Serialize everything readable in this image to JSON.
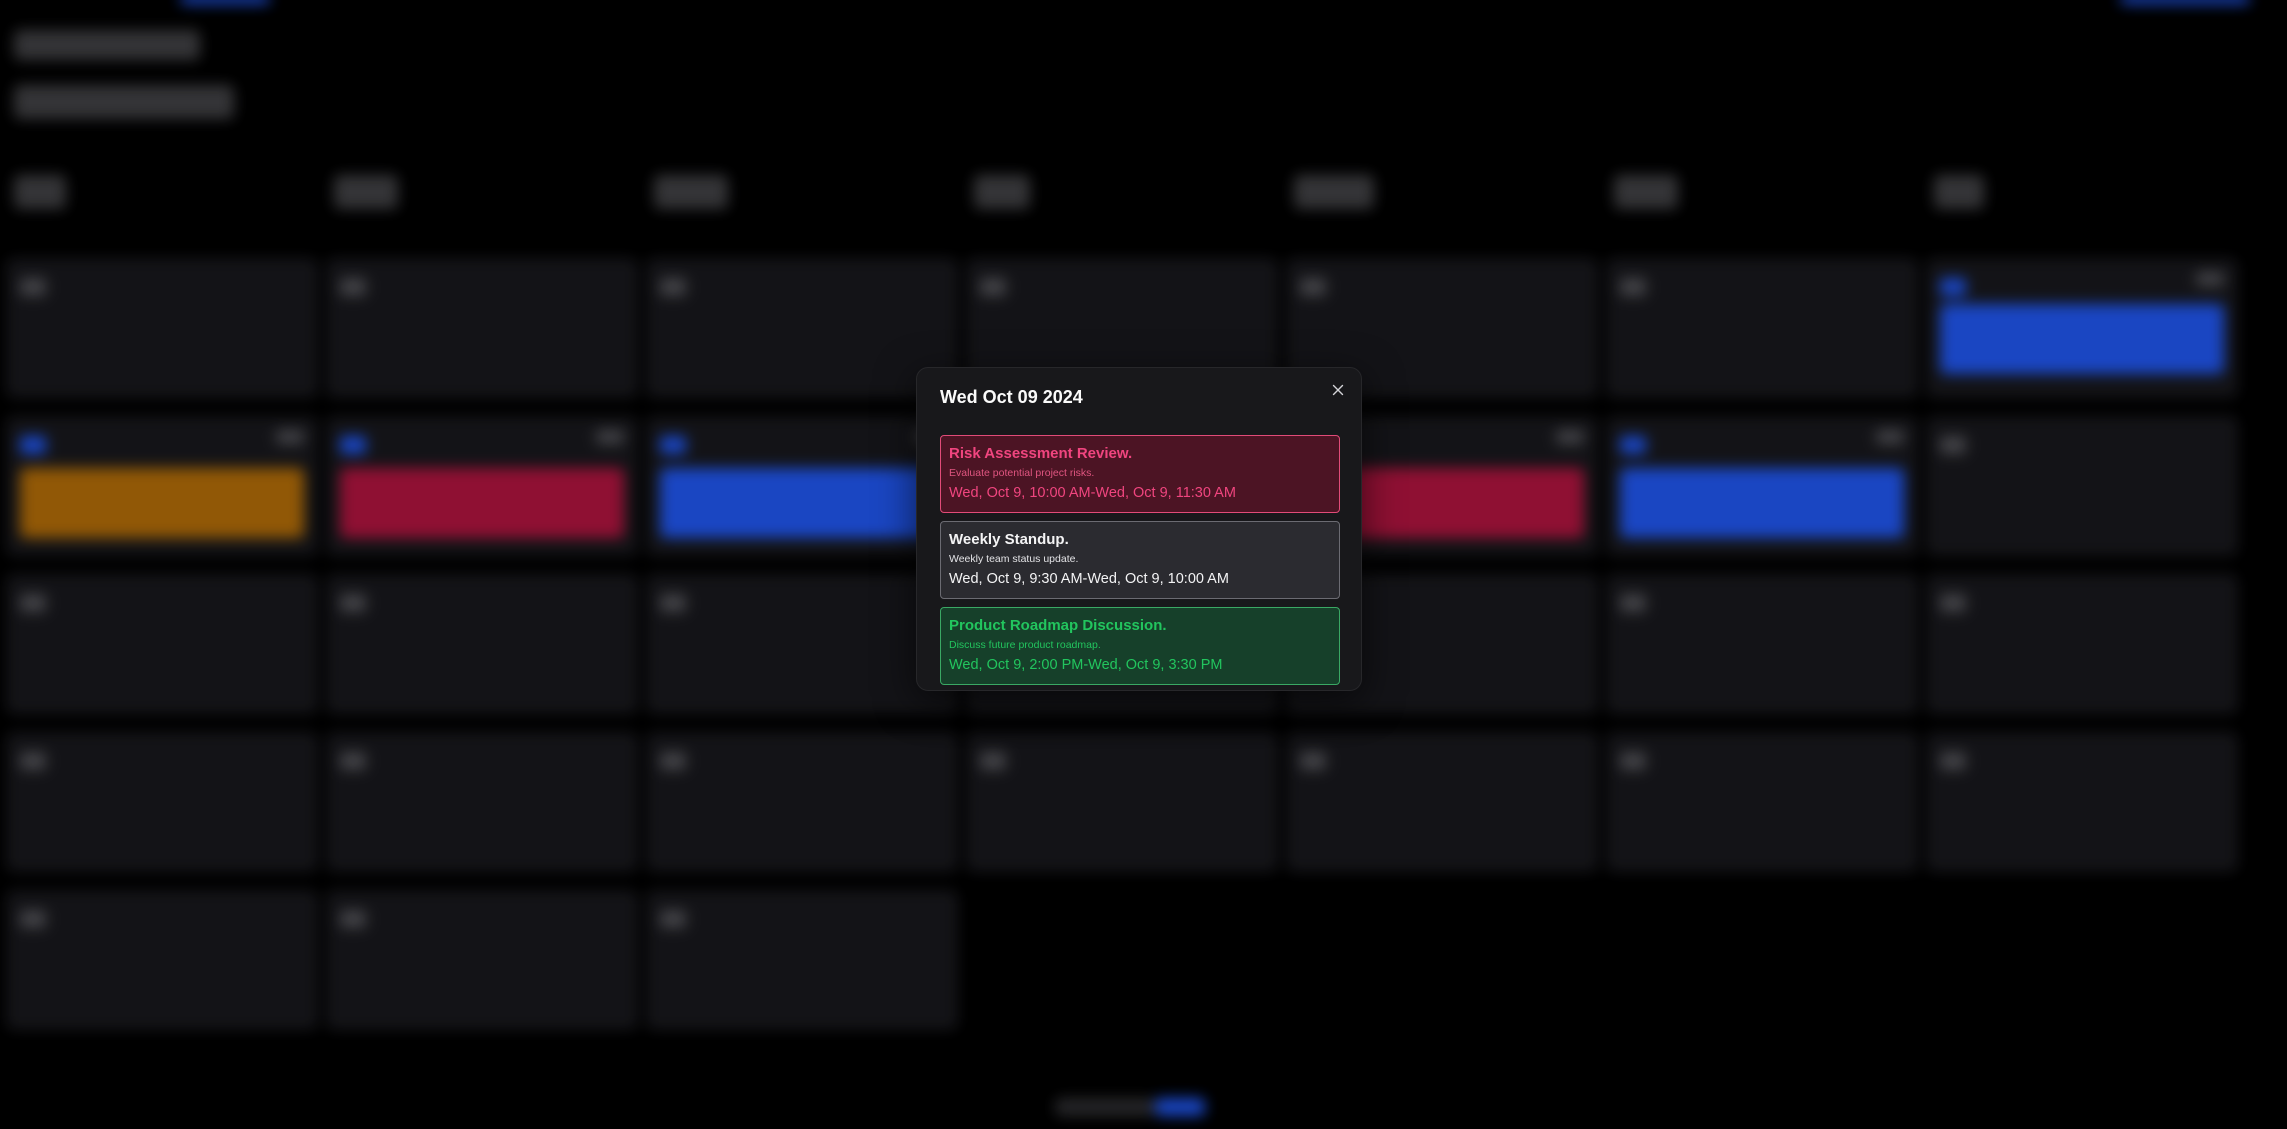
{
  "modal": {
    "title": "Wed Oct 09 2024",
    "close_icon": "close-icon",
    "events": [
      {
        "title": "Risk Assessment Review.",
        "description": "Evaluate potential project risks.",
        "time": "Wed, Oct 9, 10:00 AM-Wed, Oct 9, 11:30 AM",
        "color": "#f0457f"
      },
      {
        "title": "Weekly Standup.",
        "description": "Weekly team status update.",
        "time": "Wed, Oct 9, 9:30 AM-Wed, Oct 9, 10:00 AM",
        "color": "#f4f4f5"
      },
      {
        "title": "Product Roadmap Discussion.",
        "description": "Discuss future product roadmap.",
        "time": "Wed, Oct 9, 2:00 PM-Wed, Oct 9, 3:30 PM",
        "color": "#22c55e"
      }
    ]
  },
  "colors": {
    "backdrop": "#000000",
    "modal_bg": "#18181b",
    "accent_blue": "#1d4ed8",
    "event_orange": "#a16207",
    "event_red": "#9f1239"
  }
}
